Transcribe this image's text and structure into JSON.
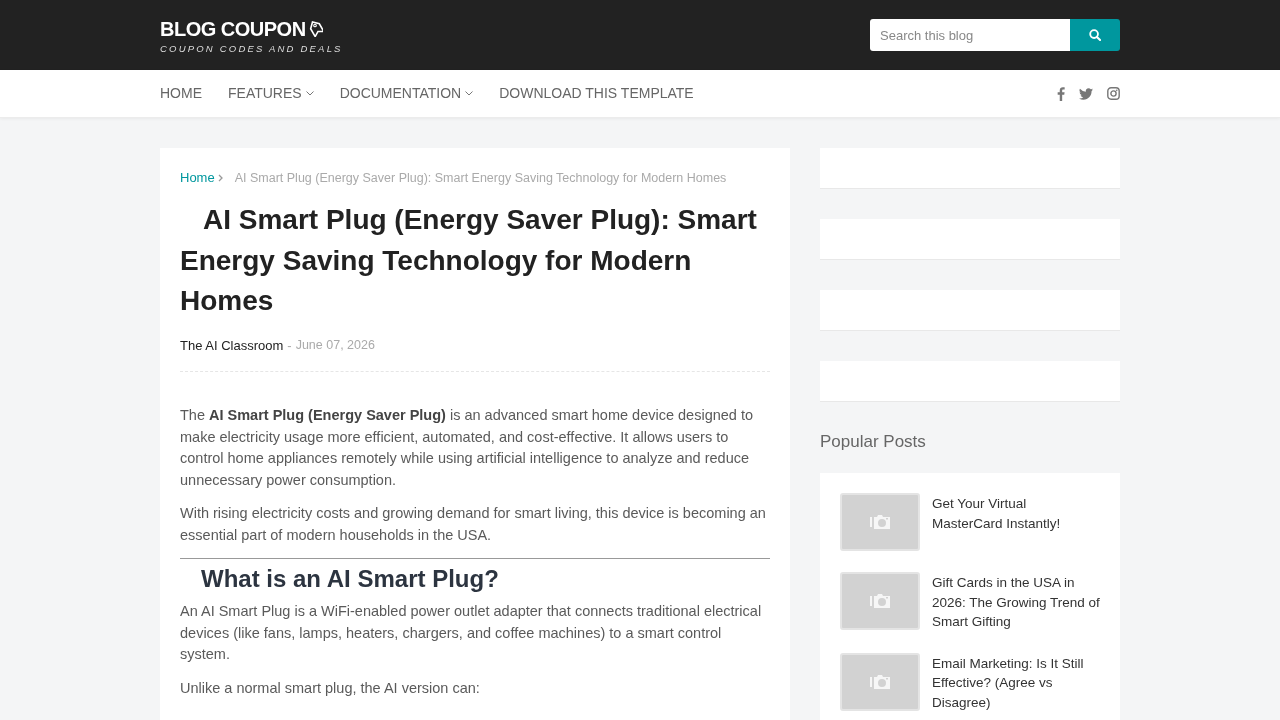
{
  "header": {
    "logo": {
      "title": "BLOG COUPON",
      "tagline": "COUPON CODES AND DEALS"
    },
    "search": {
      "placeholder": "Search this blog"
    }
  },
  "nav": {
    "items": [
      {
        "label": "HOME",
        "has_dropdown": false
      },
      {
        "label": "FEATURES",
        "has_dropdown": true
      },
      {
        "label": "DOCUMENTATION",
        "has_dropdown": true
      },
      {
        "label": "DOWNLOAD THIS TEMPLATE",
        "has_dropdown": false
      }
    ]
  },
  "post": {
    "breadcrumb": {
      "home": "Home",
      "current": "AI Smart Plug (Energy Saver Plug): Smart Energy Saving Technology for Modern Homes"
    },
    "title": "AI Smart Plug (Energy Saver Plug): Smart Energy Saving Technology for Modern Homes",
    "author": "The AI Classroom",
    "separator": "-",
    "date": "June 07, 2026",
    "body": [
      {
        "kind": "paragraph",
        "text": "The **AI Smart Plug (Energy Saver Plug)** is an advanced smart home device designed to make electricity usage more efficient, automated, and cost-effective. It allows users to control home appliances remotely while using artificial intelligence to analyze and reduce unnecessary power consumption."
      },
      {
        "kind": "paragraph",
        "text": "With rising electricity costs and growing demand for smart living, this device is becoming an essential part of modern households in the USA."
      },
      {
        "kind": "heading",
        "text": "What is an AI Smart Plug?"
      },
      {
        "kind": "paragraph",
        "text": "An AI Smart Plug is a WiFi-enabled power outlet adapter that connects traditional electrical devices (like fans, lamps, heaters, chargers, and coffee machines) to a smart control system."
      },
      {
        "kind": "paragraph",
        "text": "Unlike a normal smart plug, the AI version can:"
      }
    ]
  },
  "sidebar": {
    "popular_posts": {
      "title": "Popular Posts",
      "posts": [
        {
          "title": "Get Your Virtual MasterCard Instantly!"
        },
        {
          "title": "Gift Cards in the USA in 2026: The Growing Trend of Smart Gifting"
        },
        {
          "title": "Email Marketing: Is It Still Effective? (Agree vs Disagree)"
        }
      ]
    }
  }
}
